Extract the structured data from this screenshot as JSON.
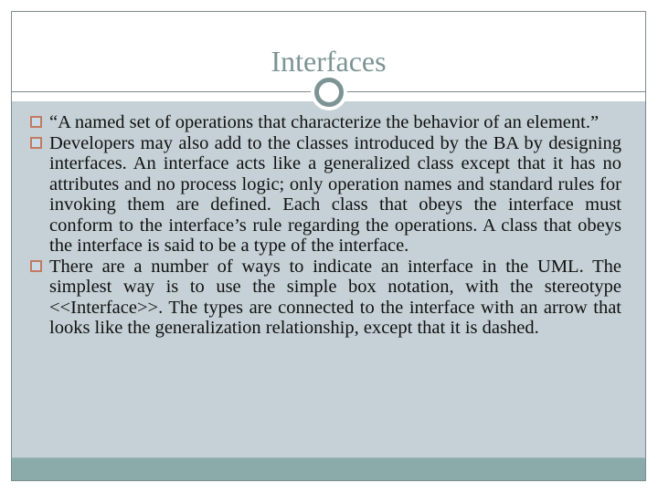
{
  "slide": {
    "title": "Interfaces",
    "bullets": [
      {
        "icon": "square-bullet-icon",
        "text": "“A named set of operations that characterize the behavior of an element.”"
      },
      {
        "icon": "square-bullet-icon",
        "text": "Developers may also add to the classes introduced by the BA by designing interfaces. An interface acts like a generalized class except that it has no attributes and no process logic; only operation names and standard rules for invoking them are defined. Each class that obeys the interface must conform to the interface’s rule regarding the operations. A class that obeys the interface is said to be a type of the interface."
      },
      {
        "icon": "square-bullet-icon",
        "text": "There are a number of ways to indicate an interface in the UML. The simplest way is to use the simple box notation, with the stereotype <<Interface>>. The types are connected to the interface with an arrow that looks like the generalization relationship, except that it is dashed."
      }
    ]
  },
  "colors": {
    "title": "#7d9494",
    "frame_border": "#7f8c8c",
    "content_background": "#c5d1d6",
    "bottom_bar": "#8aabaa",
    "bullet_stroke": "#c47a62",
    "ornament_ring": "#7d9494"
  }
}
